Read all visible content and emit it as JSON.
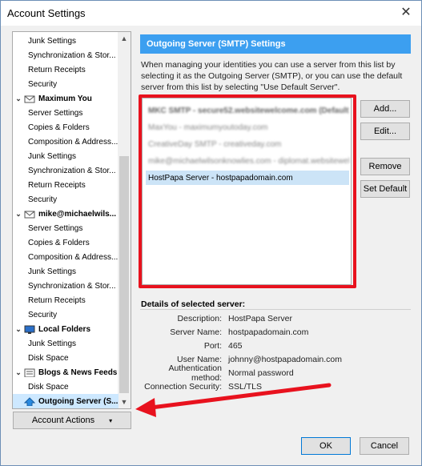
{
  "window": {
    "title": "Account Settings",
    "close_glyph": "✕"
  },
  "tree": {
    "items": [
      {
        "label": "Junk Settings",
        "kind": "child"
      },
      {
        "label": "Synchronization & Stor...",
        "kind": "child"
      },
      {
        "label": "Return Receipts",
        "kind": "child"
      },
      {
        "label": "Security",
        "kind": "child"
      },
      {
        "label": "Maximum You",
        "kind": "parent",
        "icon": "mail-account-icon"
      },
      {
        "label": "Server Settings",
        "kind": "child"
      },
      {
        "label": "Copies & Folders",
        "kind": "child"
      },
      {
        "label": "Composition & Address...",
        "kind": "child"
      },
      {
        "label": "Junk Settings",
        "kind": "child"
      },
      {
        "label": "Synchronization & Stor...",
        "kind": "child"
      },
      {
        "label": "Return Receipts",
        "kind": "child"
      },
      {
        "label": "Security",
        "kind": "child"
      },
      {
        "label": "mike@michaelwils...",
        "kind": "parent",
        "icon": "mail-account-icon"
      },
      {
        "label": "Server Settings",
        "kind": "child"
      },
      {
        "label": "Copies & Folders",
        "kind": "child"
      },
      {
        "label": "Composition & Address...",
        "kind": "child"
      },
      {
        "label": "Junk Settings",
        "kind": "child"
      },
      {
        "label": "Synchronization & Stor...",
        "kind": "child"
      },
      {
        "label": "Return Receipts",
        "kind": "child"
      },
      {
        "label": "Security",
        "kind": "child"
      },
      {
        "label": "Local Folders",
        "kind": "parent",
        "icon": "computer-icon"
      },
      {
        "label": "Junk Settings",
        "kind": "child"
      },
      {
        "label": "Disk Space",
        "kind": "child"
      },
      {
        "label": "Blogs & News Feeds",
        "kind": "parent",
        "icon": "feeds-icon"
      },
      {
        "label": "Disk Space",
        "kind": "child"
      },
      {
        "label": "Outgoing Server (S...",
        "kind": "outgoing",
        "icon": "outgoing-server-icon"
      }
    ]
  },
  "account_actions": {
    "label": "Account Actions",
    "dropdown_glyph": "▾"
  },
  "panel": {
    "header": "Outgoing Server (SMTP) Settings",
    "description": "When managing your identities you can use a server from this list by selecting it as the Outgoing Server (SMTP), or you can use the default server from this list by selecting \"Use Default Server\"."
  },
  "servers": [
    {
      "label": "MKC SMTP - secure52.websitewelcome.com (Default)",
      "blurred": true,
      "default": true
    },
    {
      "label": "MaxYou - maximumyoutoday.com",
      "blurred": true
    },
    {
      "label": "CreativeDay SMTP - creativeday.com",
      "blurred": true
    },
    {
      "label": "mike@michaelwilsonknowlies.com - diplomat.websitewel...",
      "blurred": true
    },
    {
      "label": "HostPapa Server - hostpapadomain.com",
      "blurred": false,
      "selected": true
    }
  ],
  "buttons": {
    "add": "Add...",
    "edit": "Edit...",
    "remove": "Remove",
    "set_default": "Set Default",
    "ok": "OK",
    "cancel": "Cancel"
  },
  "details": {
    "label": "Details of selected server:",
    "rows": [
      {
        "key": "Description:",
        "value": "HostPapa Server"
      },
      {
        "key": "Server Name:",
        "value": "hostpapadomain.com"
      },
      {
        "key": "Port:",
        "value": "465"
      },
      {
        "key": "User Name:",
        "value": "johnny@hostpapadomain.com"
      },
      {
        "key": "Authentication method:",
        "value": "Normal password"
      },
      {
        "key": "Connection Security:",
        "value": "SSL/TLS"
      }
    ]
  },
  "colors": {
    "header_blue": "#3c9ff0",
    "annotation_red": "#e8121e",
    "selection": "#cce4f7"
  }
}
